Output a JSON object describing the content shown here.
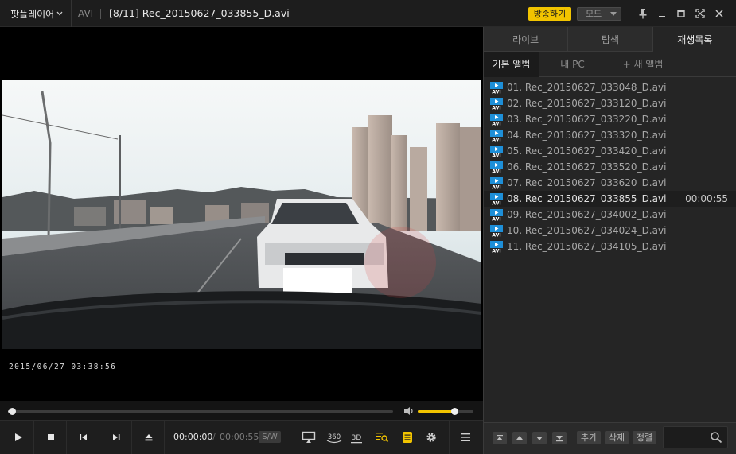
{
  "titlebar": {
    "app_menu_label": "팟플레이어",
    "format_label": "AVI",
    "file_title": "[8/11]  Rec_20150627_033855_D.avi",
    "broadcast_label": "방송하기",
    "mode_label": "모드"
  },
  "video": {
    "timestamp": "2015/06/27  03:38:56"
  },
  "seek": {
    "progress": 0.01,
    "volume": 0.65
  },
  "controls": {
    "current_time": "00:00:00",
    "slash": "/",
    "total_time": "00:00:55",
    "sw_label": "S/W",
    "icon_360": "360",
    "icon_3d": "3D"
  },
  "panel": {
    "tabs": [
      {
        "label": "라이브",
        "active": false
      },
      {
        "label": "탐색",
        "active": false
      },
      {
        "label": "재생목록",
        "active": true
      }
    ],
    "subtabs": [
      {
        "label": "기본 앨범",
        "active": true
      },
      {
        "label": "내 PC",
        "active": false
      },
      {
        "label": "+ 새 앨범",
        "active": false
      }
    ],
    "playlist": [
      {
        "label": "01. Rec_20150627_033048_D.avi",
        "duration": "",
        "active": false
      },
      {
        "label": "02. Rec_20150627_033120_D.avi",
        "duration": "",
        "active": false
      },
      {
        "label": "03. Rec_20150627_033220_D.avi",
        "duration": "",
        "active": false
      },
      {
        "label": "04. Rec_20150627_033320_D.avi",
        "duration": "",
        "active": false
      },
      {
        "label": "05. Rec_20150627_033420_D.avi",
        "duration": "",
        "active": false
      },
      {
        "label": "06. Rec_20150627_033520_D.avi",
        "duration": "",
        "active": false
      },
      {
        "label": "07. Rec_20150627_033620_D.avi",
        "duration": "",
        "active": false
      },
      {
        "label": "08. Rec_20150627_033855_D.avi",
        "duration": "00:00:55",
        "active": true
      },
      {
        "label": "09. Rec_20150627_034002_D.avi",
        "duration": "",
        "active": false
      },
      {
        "label": "10. Rec_20150627_034024_D.avi",
        "duration": "",
        "active": false
      },
      {
        "label": "11. Rec_20150627_034105_D.avi",
        "duration": "",
        "active": false
      }
    ],
    "file_icon_label": "AVI",
    "bottom": {
      "add_label": "추가",
      "delete_label": "삭제",
      "sort_label": "정렬",
      "search_placeholder": ""
    }
  },
  "colors": {
    "accent": "#f2c400",
    "file_icon": "#1e8fd8"
  }
}
